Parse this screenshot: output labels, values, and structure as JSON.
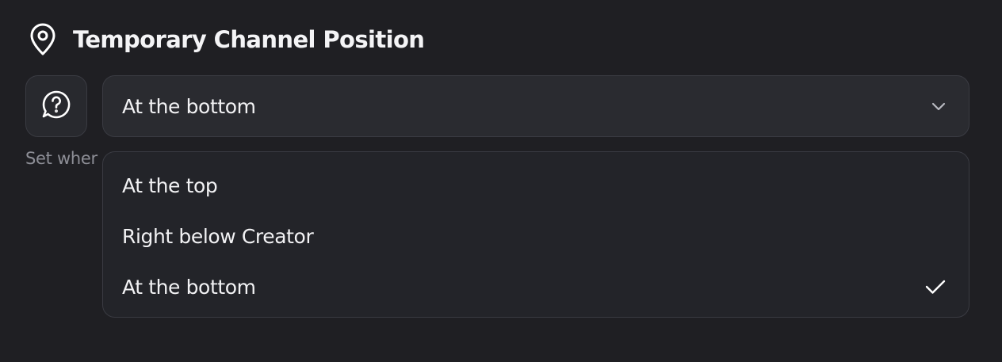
{
  "header": {
    "title": "Temporary Channel Position",
    "icon": "map-pin-icon"
  },
  "help": {
    "icon": "help-chat-icon"
  },
  "select": {
    "value": "At the bottom",
    "icon": "chevron-down-icon"
  },
  "description": {
    "text": "Set wher"
  },
  "dropdown": {
    "options": [
      {
        "label": "At the top",
        "selected": false
      },
      {
        "label": "Right below Creator",
        "selected": false
      },
      {
        "label": "At the bottom",
        "selected": true
      }
    ],
    "selected_icon": "check-icon"
  },
  "colors": {
    "background": "#1f1f23",
    "panel": "#2a2b30",
    "border": "#3a3b42",
    "muted_text": "#8d8e96"
  }
}
